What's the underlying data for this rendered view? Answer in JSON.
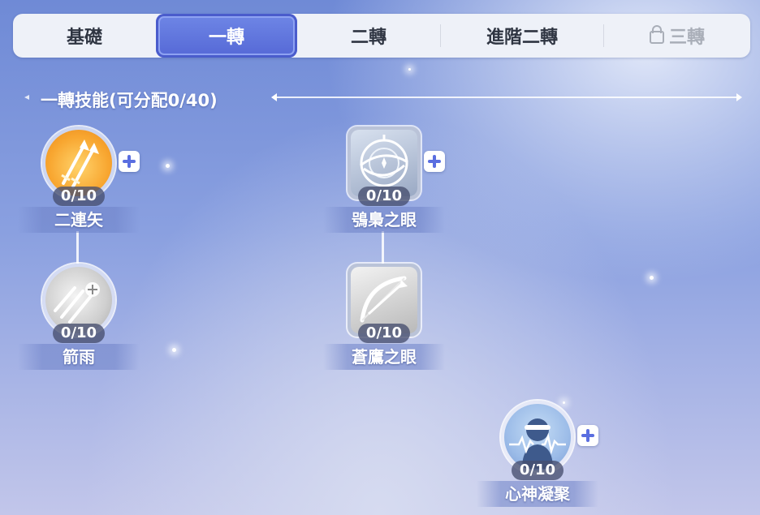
{
  "tabs": [
    {
      "label": "基礎",
      "active": false,
      "locked": false
    },
    {
      "label": "一轉",
      "active": true,
      "locked": false
    },
    {
      "label": "二轉",
      "active": false,
      "locked": false
    },
    {
      "label": "進階二轉",
      "active": false,
      "locked": false
    },
    {
      "label": "三轉",
      "active": false,
      "locked": true
    }
  ],
  "section": {
    "title": "一轉技能(可分配0/40)"
  },
  "skills": [
    {
      "name": "二連矢",
      "level": "0/10",
      "icon": "double-arrow-icon",
      "can_add": true
    },
    {
      "name": "箭雨",
      "level": "0/10",
      "icon": "arrow-rain-icon",
      "can_add": false
    },
    {
      "name": "鴞梟之眼",
      "level": "0/10",
      "icon": "owl-eye-icon",
      "can_add": true
    },
    {
      "name": "蒼鷹之眼",
      "level": "0/10",
      "icon": "hawk-eye-bow-icon",
      "can_add": false
    },
    {
      "name": "心神凝聚",
      "level": "0/10",
      "icon": "focus-heartbeat-icon",
      "can_add": true
    }
  ],
  "colors": {
    "accent": "#5a6ee0",
    "tab_active": "#5f75de",
    "level_badge": "#464e6e"
  }
}
